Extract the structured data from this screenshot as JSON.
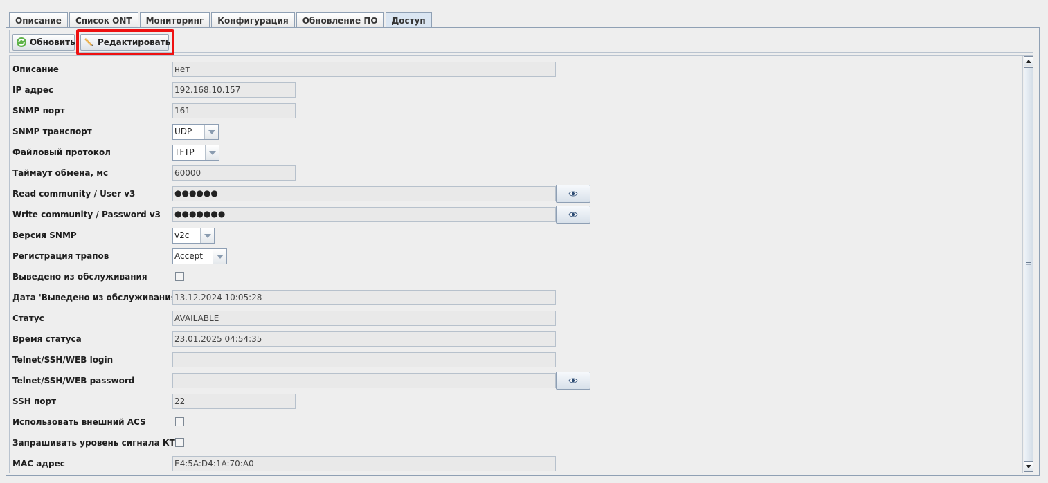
{
  "tabs": [
    {
      "label": "Описание",
      "active": false
    },
    {
      "label": "Список ONT",
      "active": false
    },
    {
      "label": "Мониторинг",
      "active": false
    },
    {
      "label": "Конфигурация",
      "active": false
    },
    {
      "label": "Обновление ПО",
      "active": false
    },
    {
      "label": "Доступ",
      "active": true
    }
  ],
  "toolbar": {
    "refresh_label": "Обновить",
    "edit_label": "Редактировать",
    "highlight_color": "#ee1111"
  },
  "form": {
    "description": {
      "label": "Описание",
      "value": "нет"
    },
    "ip": {
      "label": "IP адрес",
      "value": "192.168.10.157"
    },
    "snmp_port": {
      "label": "SNMP порт",
      "value": "161"
    },
    "snmp_transport": {
      "label": "SNMP транспорт",
      "value": "UDP"
    },
    "file_protocol": {
      "label": "Файловый протокол",
      "value": "TFTP"
    },
    "timeout": {
      "label": "Таймаут обмена, мс",
      "value": "60000"
    },
    "read_community": {
      "label": "Read community / User v3",
      "value": "●●●●●●"
    },
    "write_community": {
      "label": "Write community / Password v3",
      "value": "●●●●●●●"
    },
    "snmp_version": {
      "label": "Версия SNMP",
      "value": "v2c"
    },
    "trap_registration": {
      "label": "Регистрация трапов",
      "value": "Accept"
    },
    "out_of_service": {
      "label": "Выведено из обслуживания",
      "checked": false
    },
    "out_of_service_date": {
      "label": "Дата 'Выведено из обслуживания'",
      "value": "13.12.2024 10:05:28"
    },
    "status": {
      "label": "Статус",
      "value": "AVAILABLE"
    },
    "status_time": {
      "label": "Время статуса",
      "value": "23.01.2025 04:54:35"
    },
    "telnet_login": {
      "label": "Telnet/SSH/WEB login",
      "value": ""
    },
    "telnet_password": {
      "label": "Telnet/SSH/WEB password",
      "value": ""
    },
    "ssh_port": {
      "label": "SSH порт",
      "value": "22"
    },
    "external_acs": {
      "label": "Использовать внешний ACS",
      "checked": false
    },
    "ktv_signal": {
      "label": "Запрашивать уровень сигнала КТВ",
      "checked": false
    },
    "mac": {
      "label": "MAC адрес",
      "value": "E4:5A:D4:1A:70:A0"
    }
  },
  "icons": {
    "refresh": "refresh-icon",
    "edit": "pencil-icon",
    "show_password": "eye-icon",
    "dropdown": "chevron-down-icon"
  }
}
